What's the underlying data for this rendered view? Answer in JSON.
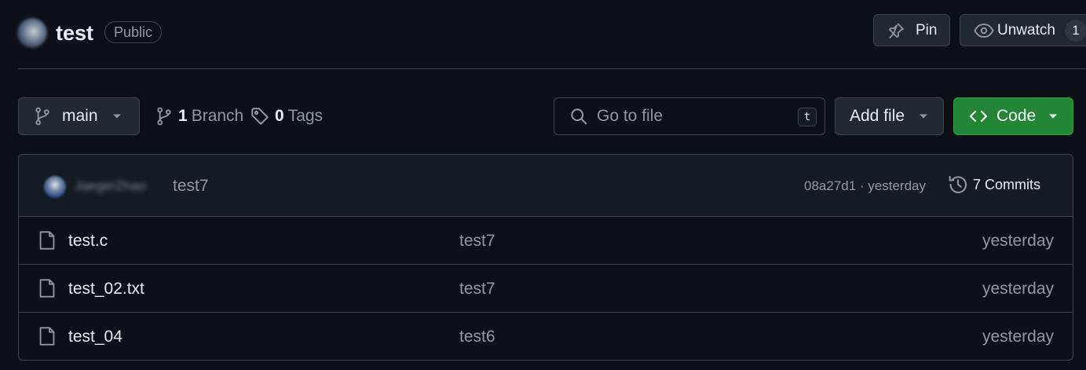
{
  "repo": {
    "name": "test",
    "visibility": "Public"
  },
  "header_actions": {
    "pin_label": "Pin",
    "unwatch_label": "Unwatch",
    "watch_count": "1"
  },
  "toolbar": {
    "branch": "main",
    "branch_count": "1",
    "branch_label": "Branch",
    "tag_count": "0",
    "tag_label": "Tags",
    "search_placeholder": "Go to file",
    "search_shortcut": "t",
    "add_file_label": "Add file",
    "code_label": "Code"
  },
  "latest_commit": {
    "author": "JaegerZhao",
    "message": "test7",
    "meta": "08a27d1 · yesterday",
    "commits_label": "7 Commits"
  },
  "files": [
    {
      "name": "test.c",
      "commit": "test7",
      "date": "yesterday"
    },
    {
      "name": "test_02.txt",
      "commit": "test7",
      "date": "yesterday"
    },
    {
      "name": "test_04",
      "commit": "test6",
      "date": "yesterday"
    }
  ],
  "colors": {
    "background": "#0d1117",
    "border": "#3d444d",
    "button_bg": "#212830",
    "code_button": "#238636",
    "text": "#e6edf3",
    "muted": "#9198a1"
  }
}
